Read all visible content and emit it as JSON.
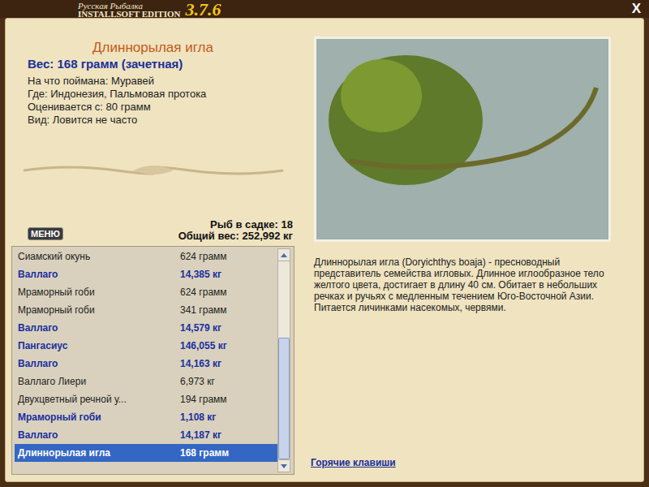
{
  "window": {
    "logo_line1": "Русская Рыбалка",
    "logo_line2": "INSTALLSOFT EDITION",
    "version": "3.7.6",
    "close": "X"
  },
  "fish": {
    "name": "Длиннорылая игла",
    "weight": "Вес: 168 грамм (зачетная)",
    "details": [
      "На что поймана: Муравей",
      "Где: Индонезия, Пальмовая протока",
      "Оценивается с: 80 грамм",
      "Вид: Ловится не часто"
    ]
  },
  "menu_button": "МЕНЮ",
  "keepnet": {
    "count": "Рыб в садке: 18",
    "total": "Общий вес: 252,992 кг"
  },
  "catch_list": {
    "scroll": 1,
    "rows": [
      {
        "name": "Сиамский окунь",
        "weight": "624 грамм",
        "valuable": false,
        "selected": false
      },
      {
        "name": "Валлаго",
        "weight": "14,385 кг",
        "valuable": true,
        "selected": false
      },
      {
        "name": "Мраморный гоби",
        "weight": "624 грамм",
        "valuable": false,
        "selected": false
      },
      {
        "name": "Мраморный гоби",
        "weight": "341 грамм",
        "valuable": false,
        "selected": false
      },
      {
        "name": "Валлаго",
        "weight": "14,579 кг",
        "valuable": true,
        "selected": false
      },
      {
        "name": "Пангасиус",
        "weight": "146,055 кг",
        "valuable": true,
        "selected": false
      },
      {
        "name": "Валлаго",
        "weight": "14,163 кг",
        "valuable": true,
        "selected": false
      },
      {
        "name": "Валлаго Лиери",
        "weight": "6,973 кг",
        "valuable": false,
        "selected": false
      },
      {
        "name": "Двухцветный речной у...",
        "weight": "194 грамм",
        "valuable": false,
        "selected": false
      },
      {
        "name": "Мраморный гоби",
        "weight": "1,108 кг",
        "valuable": true,
        "selected": false
      },
      {
        "name": "Валлаго",
        "weight": "14,187 кг",
        "valuable": true,
        "selected": false
      },
      {
        "name": "Длиннорылая игла",
        "weight": "168 грамм",
        "valuable": false,
        "selected": true
      }
    ]
  },
  "description": "Длиннорылая игла (Doryichthys boaja) - пресноводный представитель семейства игловых. Длинное иглообразное тело желтого цвета, достигает в длину 40 см. Обитает в небольших речках и ручьях с медленным течением Юго-Восточной Азии. Питается личинками насекомых, червями.",
  "hotkeys_link": "Горячие клавиши"
}
